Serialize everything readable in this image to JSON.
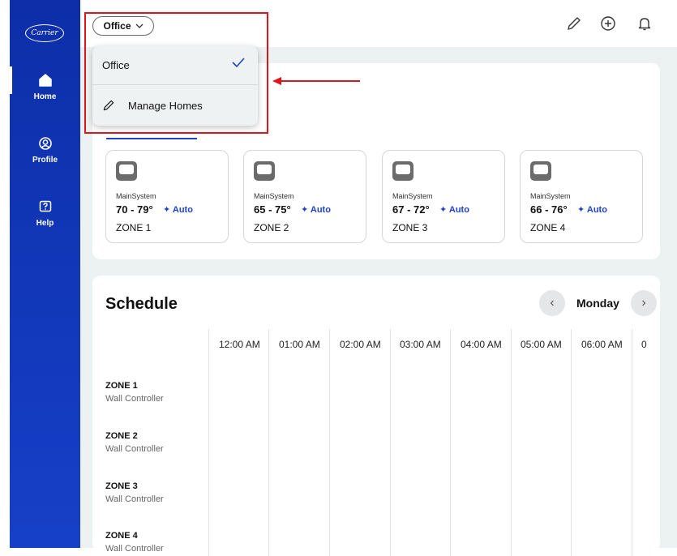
{
  "brand": {
    "logo_text": "Carrier"
  },
  "sidebar": {
    "items": [
      {
        "label": "Home",
        "icon": "home-icon"
      },
      {
        "label": "Profile",
        "icon": "user-icon"
      },
      {
        "label": "Help",
        "icon": "help-icon"
      }
    ]
  },
  "header": {
    "home_select": "Office",
    "icons": [
      "edit-icon",
      "add-icon",
      "bell-icon"
    ]
  },
  "dropdown": {
    "selected_option": "Office",
    "manage_label": "Manage Homes"
  },
  "zones": [
    {
      "system": "MainSystem",
      "temp_range": "70 - 79°",
      "mode": "Auto",
      "name": "ZONE 1"
    },
    {
      "system": "MainSystem",
      "temp_range": "65 - 75°",
      "mode": "Auto",
      "name": "ZONE 2"
    },
    {
      "system": "MainSystem",
      "temp_range": "67 - 72°",
      "mode": "Auto",
      "name": "ZONE 3"
    },
    {
      "system": "MainSystem",
      "temp_range": "66 - 76°",
      "mode": "Auto",
      "name": "ZONE 4"
    }
  ],
  "schedule": {
    "title": "Schedule",
    "day": "Monday",
    "times": [
      "12:00 AM",
      "01:00 AM",
      "02:00 AM",
      "03:00 AM",
      "04:00 AM",
      "05:00 AM",
      "06:00 AM",
      "0"
    ],
    "rows": [
      {
        "zone": "ZONE 1",
        "device": "Wall Controller"
      },
      {
        "zone": "ZONE 2",
        "device": "Wall Controller"
      },
      {
        "zone": "ZONE 3",
        "device": "Wall Controller"
      },
      {
        "zone": "ZONE 4",
        "device": "Wall Controller"
      }
    ]
  },
  "colors": {
    "sidebar": "#1236b8",
    "accent": "#1f42c8",
    "highlight": "#e0141b"
  }
}
